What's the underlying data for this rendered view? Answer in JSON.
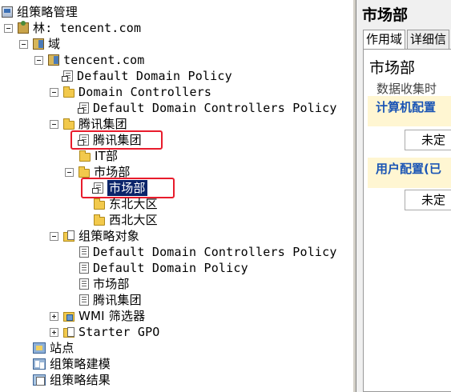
{
  "tree": {
    "root": "组策略管理",
    "forest": "林: tencent.com",
    "domains": "域",
    "domain": "tencent.com",
    "default_domain_policy": "Default Domain Policy",
    "domain_controllers": "Domain Controllers",
    "default_dc_policy": "Default Domain Controllers Policy",
    "ou_tencent_group": "腾讯集团",
    "gpo_link_tencent_group": "腾讯集团",
    "ou_it": "IT部",
    "ou_marketing": "市场部",
    "gpo_link_marketing": "市场部",
    "ou_northwest": "东北大区",
    "ou_northwest2": "西北大区",
    "gpo_objects": "组策略对象",
    "gpo_default_dc": "Default Domain Controllers Policy",
    "gpo_default_domain": "Default Domain Policy",
    "gpo_marketing": "市场部",
    "gpo_tencent_group": "腾讯集团",
    "wmi_filters": "WMI 筛选器",
    "starter_gpo": "Starter GPO",
    "sites": "站点",
    "modeling": "组策略建模",
    "results": "组策略结果"
  },
  "details": {
    "header_title": "市场部",
    "tab_scope": "作用域",
    "tab_details": "详细信",
    "gpo_name": "市场部",
    "collected_at": "数据收集时",
    "computer_config": "计算机配置",
    "computer_status": "未定",
    "user_config": "用户配置(已",
    "user_status": "未定"
  }
}
